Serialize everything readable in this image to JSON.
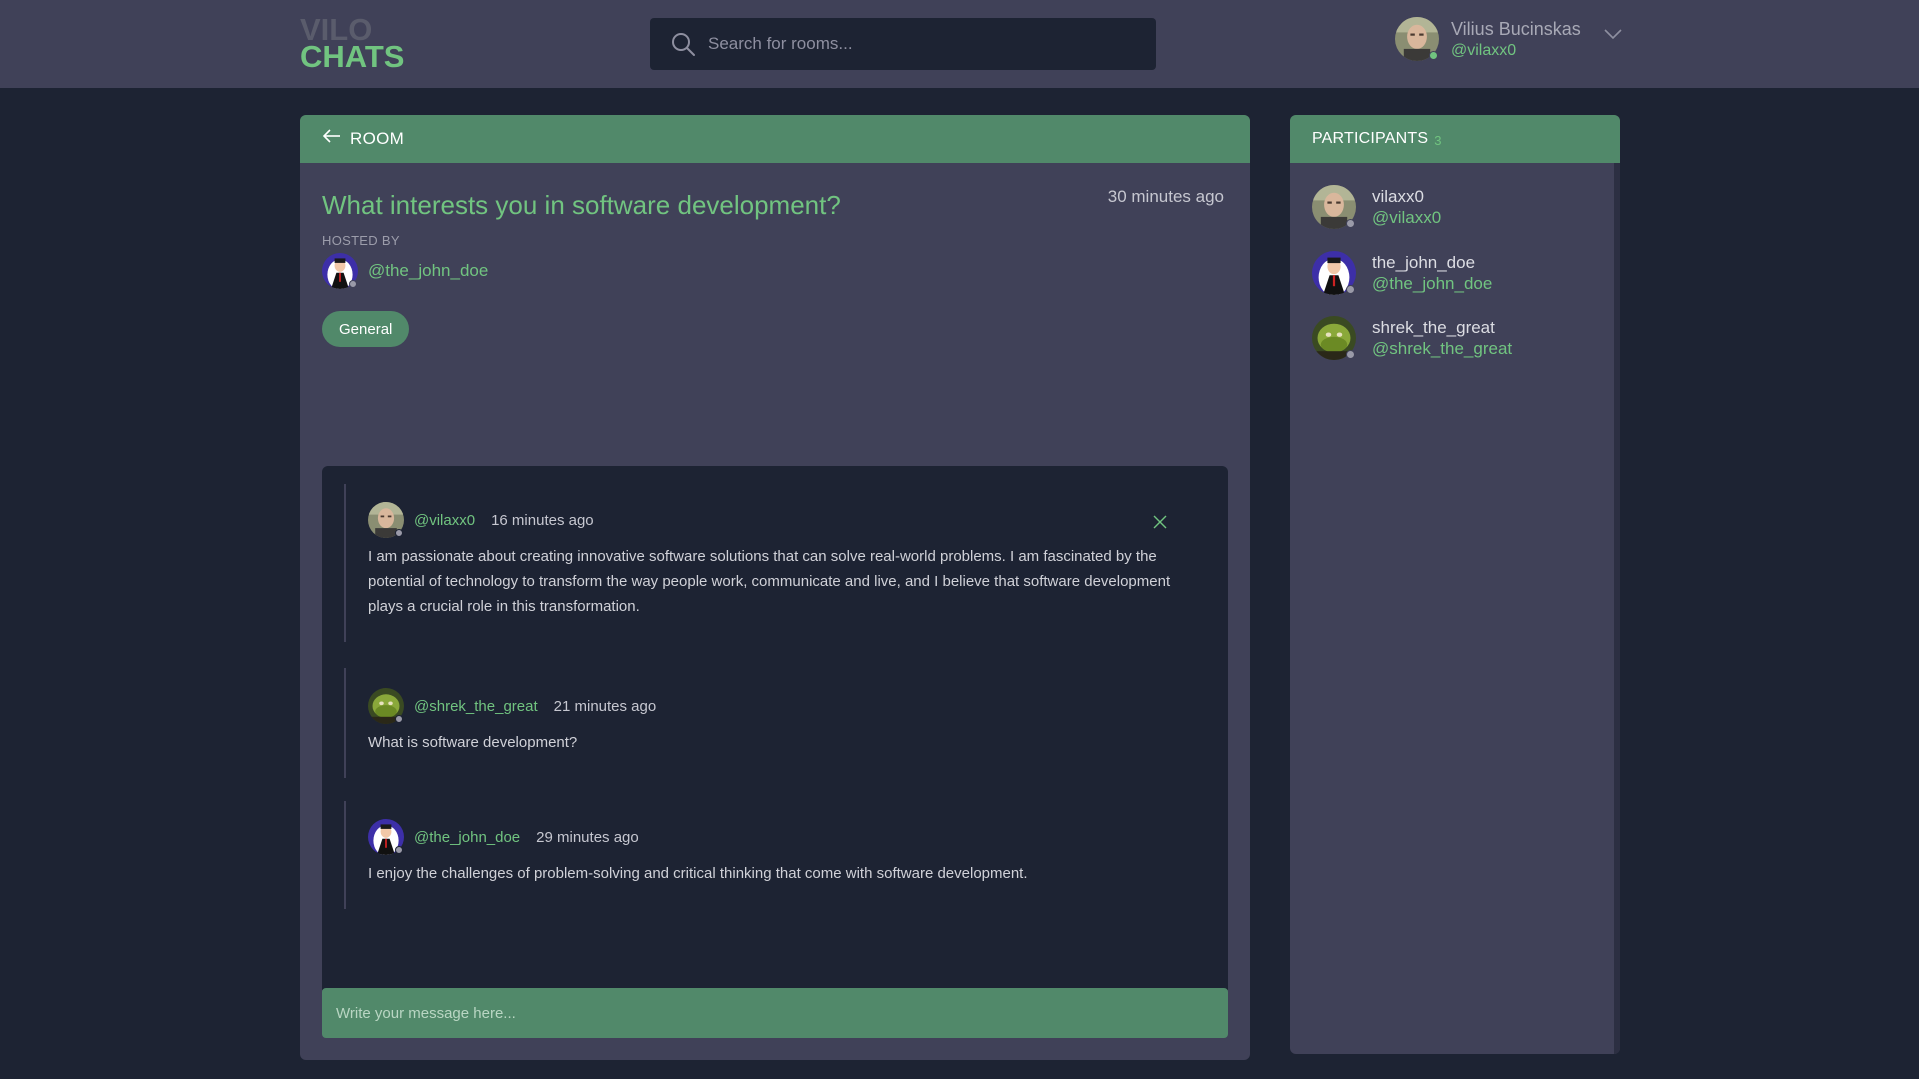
{
  "header": {
    "logo_line1": "VILO",
    "logo_line2": "CHATS",
    "search_placeholder": "Search for rooms...",
    "user": {
      "full_name": "Vilius Bucinskas",
      "handle": "@vilaxx0"
    }
  },
  "room": {
    "header_label": "ROOM",
    "title": "What interests you in software development?",
    "time": "30 minutes ago",
    "hosted_by_label": "HOSTED BY",
    "host_handle": "@the_john_doe",
    "topic": "General",
    "messages": [
      {
        "author": "@vilaxx0",
        "time": "16 minutes ago",
        "body": "I am passionate about creating innovative software solutions that can solve real-world problems. I am fascinated by the potential of technology to transform the way people work, communicate and live, and I believe that software development plays a crucial role in this transformation."
      },
      {
        "author": "@shrek_the_great",
        "time": "21 minutes ago",
        "body": "What is software development?"
      },
      {
        "author": "@the_john_doe",
        "time": "29 minutes ago",
        "body": "I enjoy the challenges of problem-solving and critical thinking that come with software development."
      }
    ],
    "compose_placeholder": "Write your message here..."
  },
  "participants": {
    "label": "PARTICIPANTS",
    "count": "3",
    "items": [
      {
        "name": "vilaxx0",
        "handle": "@vilaxx0"
      },
      {
        "name": "the_john_doe",
        "handle": "@the_john_doe"
      },
      {
        "name": "shrek_the_great",
        "handle": "@shrek_the_great"
      }
    ]
  },
  "colors": {
    "accent": "#71c480",
    "accent_dark": "#51896a",
    "panel": "#404158",
    "background": "#1d2333",
    "online": "#71c480",
    "offline": "#9a9aa8"
  },
  "icons": {
    "search": "search-icon",
    "back": "arrow-left-icon",
    "dropdown": "chevron-down-icon",
    "delete": "close-icon"
  }
}
